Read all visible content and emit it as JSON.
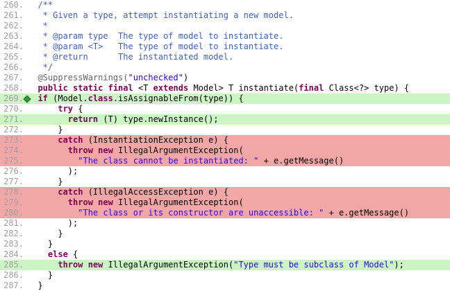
{
  "colors": {
    "covered_bg": "#ccf5c4",
    "missed_bg": "#f3a6a6",
    "comment": "#3f5fbf",
    "keyword": "#7f0055",
    "string": "#2a00ff",
    "line_number": "#a0a0a0"
  },
  "lines": [
    {
      "num": "260.",
      "status": "none",
      "marker": false,
      "segments": [
        {
          "t": "  /**",
          "c": "c"
        }
      ]
    },
    {
      "num": "261.",
      "status": "none",
      "marker": false,
      "segments": [
        {
          "t": "   * Given a type, attempt instantiating a new model.",
          "c": "c"
        }
      ]
    },
    {
      "num": "262.",
      "status": "none",
      "marker": false,
      "segments": [
        {
          "t": "   *",
          "c": "c"
        }
      ]
    },
    {
      "num": "263.",
      "status": "none",
      "marker": false,
      "segments": [
        {
          "t": "   * @param type  The type of model to instantiate.",
          "c": "c"
        }
      ]
    },
    {
      "num": "264.",
      "status": "none",
      "marker": false,
      "segments": [
        {
          "t": "   * @param <T>   The type of model to instantiate.",
          "c": "c"
        }
      ]
    },
    {
      "num": "265.",
      "status": "none",
      "marker": false,
      "segments": [
        {
          "t": "   * @return      The instantiated model.",
          "c": "c"
        }
      ]
    },
    {
      "num": "266.",
      "status": "none",
      "marker": false,
      "segments": [
        {
          "t": "   */",
          "c": "c"
        }
      ]
    },
    {
      "num": "267.",
      "status": "none",
      "marker": false,
      "segments": [
        {
          "t": "  @SuppressWarnings(",
          "c": "a"
        },
        {
          "t": "\"unchecked\"",
          "c": "s"
        },
        {
          "t": ")",
          "c": "t"
        }
      ]
    },
    {
      "num": "268.",
      "status": "none",
      "marker": false,
      "segments": [
        {
          "t": "  ",
          "c": "t"
        },
        {
          "t": "public static final",
          "c": "k"
        },
        {
          "t": " <T ",
          "c": "t"
        },
        {
          "t": "extends",
          "c": "k"
        },
        {
          "t": " Model> T instantiate(",
          "c": "t"
        },
        {
          "t": "final",
          "c": "k"
        },
        {
          "t": " Class<?> type) {",
          "c": "t"
        }
      ]
    },
    {
      "num": "269.",
      "status": "covered",
      "marker": true,
      "segments": [
        {
          "t": "  ",
          "c": "t"
        },
        {
          "t": "if",
          "c": "k"
        },
        {
          "t": " (Model.",
          "c": "t"
        },
        {
          "t": "class",
          "c": "k"
        },
        {
          "t": ".isAssignableFrom(type)) {",
          "c": "t"
        }
      ]
    },
    {
      "num": "270.",
      "status": "none",
      "marker": false,
      "segments": [
        {
          "t": "      ",
          "c": "t"
        },
        {
          "t": "try",
          "c": "k"
        },
        {
          "t": " {",
          "c": "t"
        }
      ]
    },
    {
      "num": "271.",
      "status": "covered",
      "marker": false,
      "segments": [
        {
          "t": "        ",
          "c": "t"
        },
        {
          "t": "return",
          "c": "k"
        },
        {
          "t": " (T) type.newInstance();",
          "c": "t"
        }
      ]
    },
    {
      "num": "272.",
      "status": "none",
      "marker": false,
      "segments": [
        {
          "t": "      }",
          "c": "t"
        }
      ]
    },
    {
      "num": "273.",
      "status": "missed",
      "marker": false,
      "segments": [
        {
          "t": "      ",
          "c": "t"
        },
        {
          "t": "catch",
          "c": "k"
        },
        {
          "t": " (InstantiationException e) {",
          "c": "t"
        }
      ]
    },
    {
      "num": "274.",
      "status": "missed",
      "marker": false,
      "segments": [
        {
          "t": "        ",
          "c": "t"
        },
        {
          "t": "throw new",
          "c": "k"
        },
        {
          "t": " IllegalArgumentException(",
          "c": "t"
        }
      ]
    },
    {
      "num": "275.",
      "status": "missed",
      "marker": false,
      "segments": [
        {
          "t": "          ",
          "c": "t"
        },
        {
          "t": "\"The class cannot be instantiated: \"",
          "c": "s"
        },
        {
          "t": " + e.getMessage()",
          "c": "t"
        }
      ]
    },
    {
      "num": "276.",
      "status": "none",
      "marker": false,
      "segments": [
        {
          "t": "        );",
          "c": "t"
        }
      ]
    },
    {
      "num": "277.",
      "status": "none",
      "marker": false,
      "segments": [
        {
          "t": "      }",
          "c": "t"
        }
      ]
    },
    {
      "num": "278.",
      "status": "missed",
      "marker": false,
      "segments": [
        {
          "t": "      ",
          "c": "t"
        },
        {
          "t": "catch",
          "c": "k"
        },
        {
          "t": " (IllegalAccessException e) {",
          "c": "t"
        }
      ]
    },
    {
      "num": "279.",
      "status": "missed",
      "marker": false,
      "segments": [
        {
          "t": "        ",
          "c": "t"
        },
        {
          "t": "throw new",
          "c": "k"
        },
        {
          "t": " IllegalArgumentException(",
          "c": "t"
        }
      ]
    },
    {
      "num": "280.",
      "status": "missed",
      "marker": false,
      "segments": [
        {
          "t": "          ",
          "c": "t"
        },
        {
          "t": "\"The class or its constructor are unaccessible: \"",
          "c": "s"
        },
        {
          "t": " + e.getMessage()",
          "c": "t"
        }
      ]
    },
    {
      "num": "281.",
      "status": "none",
      "marker": false,
      "segments": [
        {
          "t": "        );",
          "c": "t"
        }
      ]
    },
    {
      "num": "282.",
      "status": "none",
      "marker": false,
      "segments": [
        {
          "t": "      }",
          "c": "t"
        }
      ]
    },
    {
      "num": "283.",
      "status": "none",
      "marker": false,
      "segments": [
        {
          "t": "    }",
          "c": "t"
        }
      ]
    },
    {
      "num": "284.",
      "status": "none",
      "marker": false,
      "segments": [
        {
          "t": "    ",
          "c": "t"
        },
        {
          "t": "else",
          "c": "k"
        },
        {
          "t": " {",
          "c": "t"
        }
      ]
    },
    {
      "num": "285.",
      "status": "covered",
      "marker": false,
      "segments": [
        {
          "t": "      ",
          "c": "t"
        },
        {
          "t": "throw new",
          "c": "k"
        },
        {
          "t": " IllegalArgumentException(",
          "c": "t"
        },
        {
          "t": "\"Type must be subclass of Model\"",
          "c": "s"
        },
        {
          "t": ");",
          "c": "t"
        }
      ]
    },
    {
      "num": "286.",
      "status": "none",
      "marker": false,
      "segments": [
        {
          "t": "    }",
          "c": "t"
        }
      ]
    },
    {
      "num": "287.",
      "status": "none",
      "marker": false,
      "segments": [
        {
          "t": "  }",
          "c": "t"
        }
      ]
    }
  ]
}
